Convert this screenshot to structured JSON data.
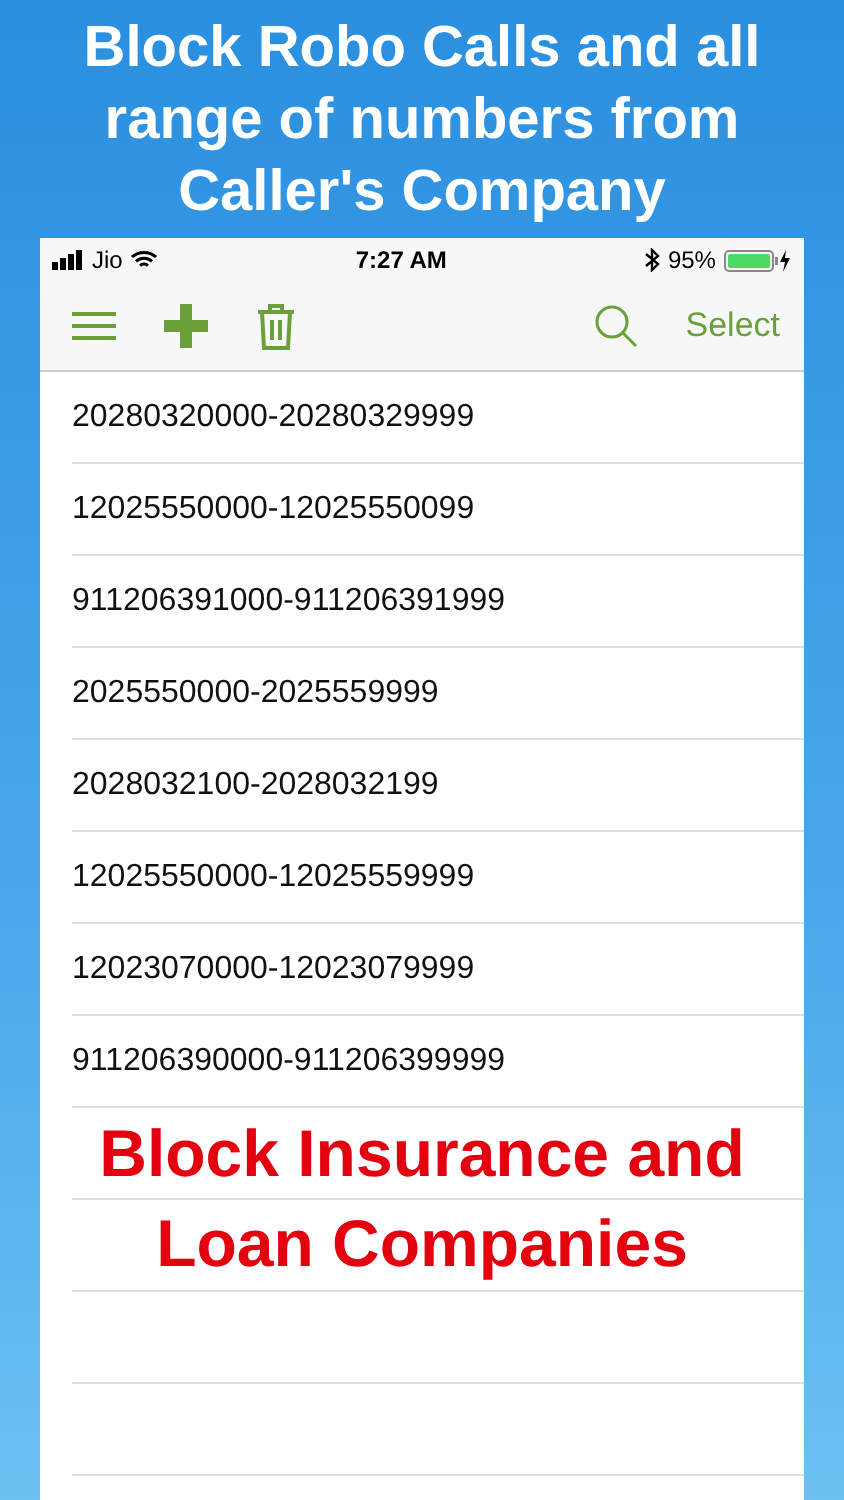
{
  "headline": "Block Robo Calls and all range of numbers from Caller's Company",
  "status_bar": {
    "carrier": "Jio",
    "time": "7:27 AM",
    "battery": "95%"
  },
  "toolbar": {
    "select": "Select"
  },
  "rows": [
    {
      "text": "20280320000-20280329999"
    },
    {
      "text": "12025550000-12025550099"
    },
    {
      "text": "911206391000-911206391999"
    },
    {
      "text": "2025550000-2025559999"
    },
    {
      "text": "2028032100-2028032199"
    },
    {
      "text": "12025550000-12025559999"
    },
    {
      "text": "12023070000-12023079999"
    },
    {
      "text": "911206390000-911206399999"
    }
  ],
  "overlay_caption": "Block Insurance and Loan Companies"
}
